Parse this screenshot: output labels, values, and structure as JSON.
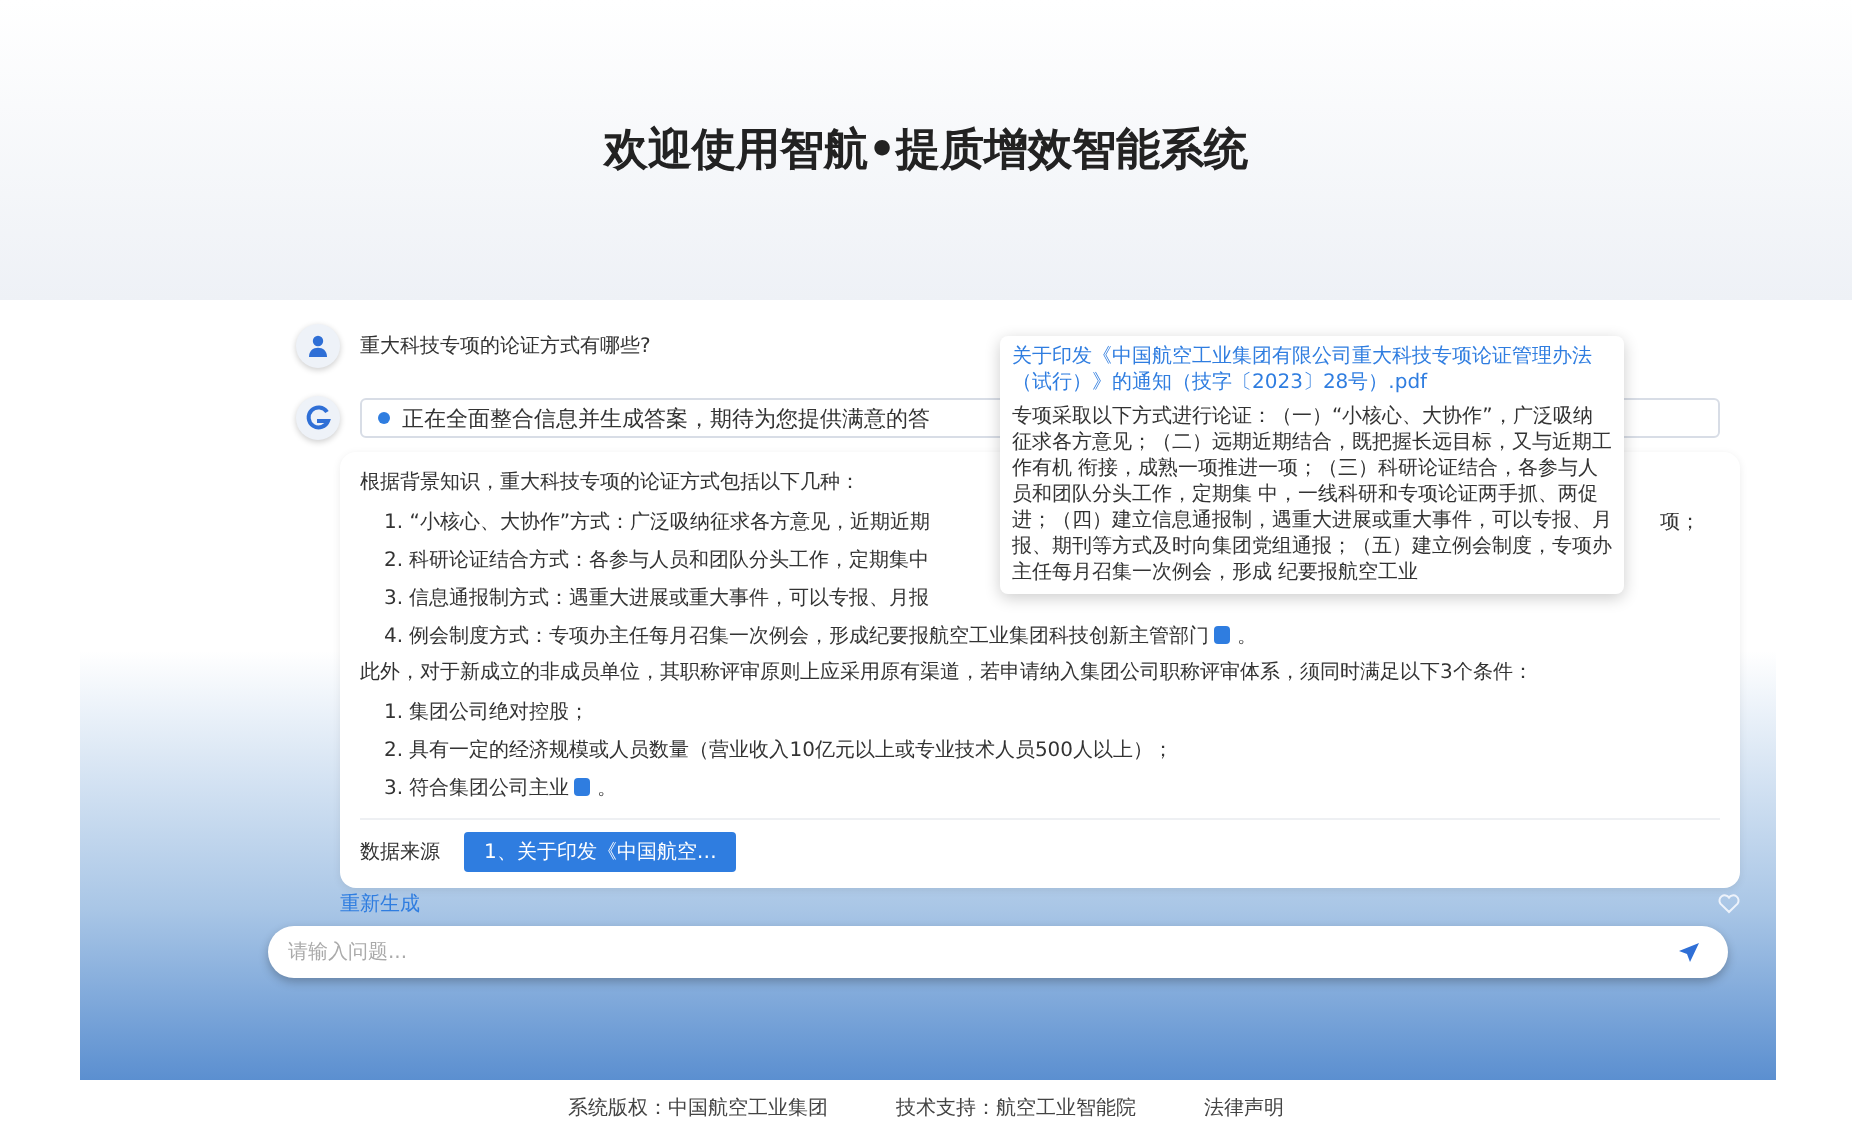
{
  "banner": {
    "title": "欢迎使用**智航•提质增效**智能系统"
  },
  "question": {
    "text": "重大科技专项的论证方式有哪些?"
  },
  "status": {
    "text": "正在全面整合信息并生成答案，期待为您提供满意的答"
  },
  "answer": {
    "intro": "根据背景知识，重大科技专项的论证方式包括以下几种：",
    "items": [
      {
        "text": "1. “小核心、大协作”方式：广泛吸纳征求各方意见，近期近期",
        "tail": "项；",
        "citation": false
      },
      {
        "text": "2. 科研论证结合方式：各参与人员和团队分头工作，定期集中",
        "citation": false
      },
      {
        "text": "3. 信息通报制方式：遇重大进展或重大事件，可以专报、月报",
        "citation": false
      },
      {
        "text": "4. 例会制度方式：专项办主任每月召集一次例会，形成纪要报航空工业集团科技创新主管部门",
        "citation": true,
        "end": "。"
      }
    ],
    "note": "此外，对于新成立的非成员单位，其职称评审原则上应采用原有渠道，若申请纳入集团公司职称评审体系，须同时满足以下3个条件：",
    "conditions": [
      {
        "text": "1. 集团公司绝对控股；",
        "citation": false
      },
      {
        "text": "2. 具有一定的经济规模或人员数量（营业收入10亿元以上或专业技术人员500人以上）；",
        "citation": false
      },
      {
        "text": "3. 符合集团公司主业",
        "citation": true,
        "end": "。"
      }
    ],
    "sources_label": "数据来源",
    "sources": [
      {
        "label": "1、关于印发《中国航空…"
      }
    ]
  },
  "popup": {
    "title": "关于印发《中国航空工业集团有限公司重大科技专项论证管理办法（试行）》的通知（技字〔2023〕28号）.pdf",
    "body": "专项采取以下方式进行论证：（一）“小核心、大协作”，广泛吸纳征求各方意见；（二）远期近期结合，既把握长远目标，又与近期工作有机 衔接，成熟一项推进一项；（三）科研论证结合，各参与人员和团队分头工作，定期集 中，一线科研和专项论证两手抓、两促进；（四）建立信息通报制，遇重大进展或重大事件，可以专报、月报、期刊等方式及时向集团党组通报；（五）建立例会制度，专项办主任每月召集一次例会，形成 纪要报航空工业"
  },
  "regenerate": "重新生成",
  "input": {
    "placeholder": "请输入问题..."
  },
  "footer": [
    "系统版权：中国航空工业集团",
    "技术支持：航空工业智能院",
    "法律声明"
  ]
}
